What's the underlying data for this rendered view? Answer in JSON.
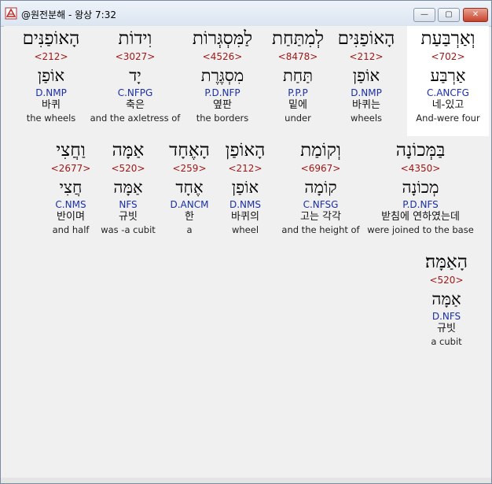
{
  "window": {
    "title": "@원전분해 - 왕상 7:32"
  },
  "controls": {
    "minimize": "—",
    "maximize": "▢",
    "close": "✕"
  },
  "rows": [
    [
      {
        "heb": "וְאַרְבַּעַת",
        "strong": "<702>",
        "lex": "אַרְבַּע",
        "parse": "C.ANCFG",
        "korean": "네-있고",
        "english": "And-were four",
        "selected": true
      },
      {
        "heb": "הָאוֹפַנִּים",
        "strong": "<212>",
        "lex": "אוֹפַן",
        "parse": "D.NMP",
        "korean": "바퀴는",
        "english": "wheels"
      },
      {
        "heb": "לְמִתַּחַת",
        "strong": "<8478>",
        "lex": "תַּחַת",
        "parse": "P.P.P",
        "korean": "밑에",
        "english": "under"
      },
      {
        "heb": "לַמִּסְגְּרוֹת",
        "strong": "<4526>",
        "lex": "מִסְגֶּרֶת",
        "parse": "P.D.NFP",
        "korean": "옆판",
        "english": "the borders"
      },
      {
        "heb": "וִידוֹת",
        "strong": "<3027>",
        "lex": "יָד",
        "parse": "C.NFPG",
        "korean": "축은",
        "english": "and the axletress of"
      },
      {
        "heb": "הָאוֹפַנִּים",
        "strong": "<212>",
        "lex": "אוֹפַן",
        "parse": "D.NMP",
        "korean": "바퀴",
        "english": "the wheels"
      }
    ],
    [
      {
        "heb": "בַּמְּכוֹנָה",
        "strong": "<4350>",
        "lex": "מְכוֹנָה",
        "parse": "P.D.NFS",
        "korean": "받침에 연하였는데",
        "english": "were joined to the base"
      },
      {
        "heb": "וְקוֹמַת",
        "strong": "<6967>",
        "lex": "קוֹמָה",
        "parse": "C.NFSG",
        "korean": "고는 각각",
        "english": "and the height of"
      },
      {
        "heb": "הָאוֹפַן",
        "strong": "<212>",
        "lex": "אוֹפַן",
        "parse": "D.NMS",
        "korean": "바퀴의",
        "english": "wheel"
      },
      {
        "heb": "הָאֶחָד",
        "strong": "<259>",
        "lex": "אֶחָד",
        "parse": "D.ANCM",
        "korean": "한",
        "english": "a"
      },
      {
        "heb": "אַמָּה",
        "strong": "<520>",
        "lex": "אַמָּה",
        "parse": "NFS",
        "korean": "규빗",
        "english": "was -a cubit"
      },
      {
        "heb": "וַחֲצִי",
        "strong": "<2677>",
        "lex": "חֲצִי",
        "parse": "C.NMS",
        "korean": "반이며",
        "english": "and half"
      }
    ],
    [
      {
        "heb": "הָאַמָּה׃",
        "strong": "<520>",
        "lex": "אַמָּה",
        "parse": "D.NFS",
        "korean": "규빗",
        "english": "a cubit"
      }
    ]
  ]
}
